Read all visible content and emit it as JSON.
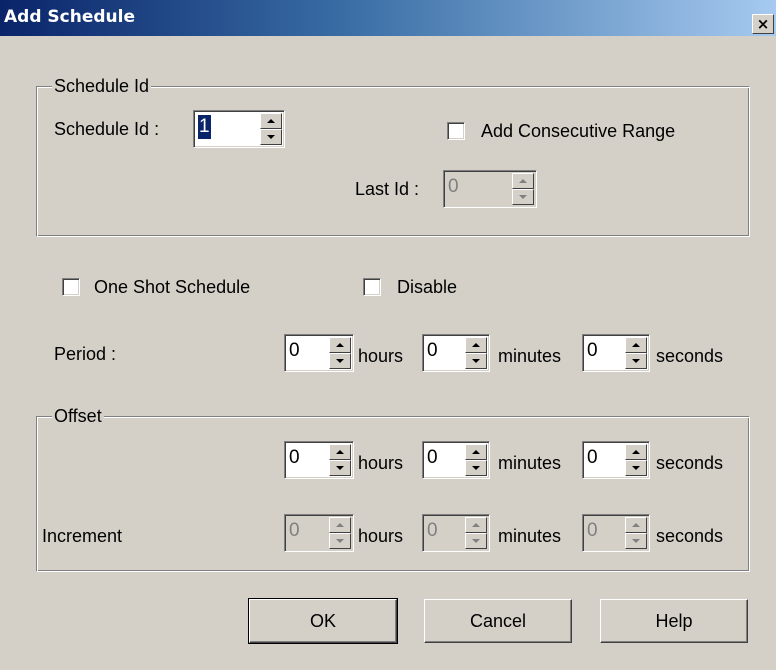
{
  "window": {
    "title": "Add Schedule",
    "close_glyph": "×"
  },
  "schedule_id_group": {
    "legend": "Schedule Id",
    "id_label": "Schedule Id :",
    "id_value": "1",
    "consecutive_label": "Add Consecutive Range",
    "consecutive_checked": false,
    "last_id_label": "Last Id :",
    "last_id_value": "0"
  },
  "options": {
    "one_shot_label": "One Shot Schedule",
    "one_shot_checked": false,
    "disable_label": "Disable",
    "disable_checked": false
  },
  "period": {
    "label": "Period :",
    "hours": "0",
    "minutes": "0",
    "seconds": "0",
    "hours_unit": "hours",
    "minutes_unit": "minutes",
    "seconds_unit": "seconds"
  },
  "offset_group": {
    "legend": "Offset",
    "hours": "0",
    "minutes": "0",
    "seconds": "0",
    "hours_unit": "hours",
    "minutes_unit": "minutes",
    "seconds_unit": "seconds"
  },
  "increment": {
    "label": "Increment",
    "hours": "0",
    "minutes": "0",
    "seconds": "0",
    "hours_unit": "hours",
    "minutes_unit": "minutes",
    "seconds_unit": "seconds"
  },
  "buttons": {
    "ok": "OK",
    "cancel": "Cancel",
    "help": "Help"
  },
  "colors": {
    "dialog_bg": "#d4d0c8",
    "title_gradient_start": "#0a246a",
    "title_gradient_end": "#a6caf0",
    "selection": "#0a246a"
  }
}
